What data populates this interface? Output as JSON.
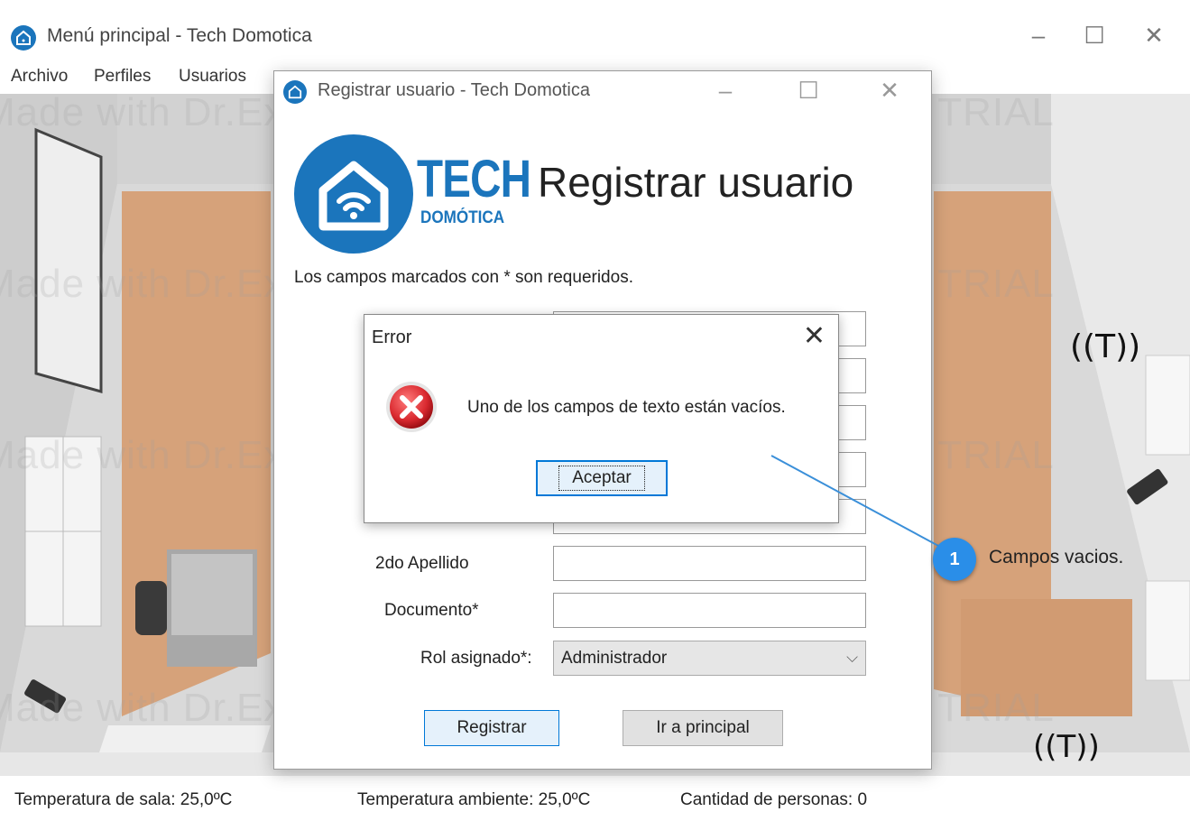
{
  "main_window": {
    "title": "Menú principal - Tech Domotica",
    "menu": [
      "Archivo",
      "Perfiles",
      "Usuarios"
    ]
  },
  "status_bar": {
    "room_temp": "Temperatura de sala: 25,0ºC",
    "ambient_temp": "Temperatura ambiente: 25,0ºC",
    "people_count": "Cantidad de personas: 0"
  },
  "register_dialog": {
    "title": "Registrar usuario - Tech Domotica",
    "logo_primary": "TECH",
    "logo_secondary": "DOMÓTICA",
    "heading": "Registrar usuario",
    "note": "Los campos marcados con * son requeridos.",
    "fields": {
      "second_surname_label": "2do Apellido",
      "document_label": "Documento*",
      "role_label": "Rol asignado*:",
      "role_value": "Administrador"
    },
    "buttons": {
      "register": "Registrar",
      "go_main": "Ir a principal"
    }
  },
  "error_dialog": {
    "title": "Error",
    "message": "Uno de los campos de texto están vacíos.",
    "accept": "Aceptar"
  },
  "annotation": {
    "number": "1",
    "text": "Campos vacios."
  },
  "watermark": "Made with Dr.Explain TRIAL",
  "colors": {
    "brand_blue": "#1b75bc",
    "error_red": "#d9292f",
    "callout_blue": "#2a8ee8"
  }
}
